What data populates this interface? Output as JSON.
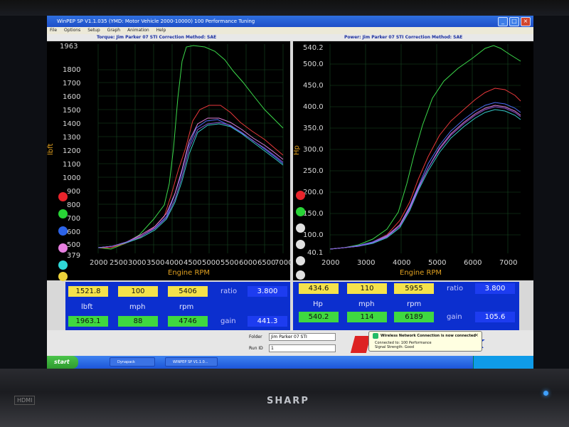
{
  "window": {
    "title": "WinPEP SP V1.1.035  (YMD: Motor Vehicle 2000-10000)  100 Performance Tuning",
    "menu": [
      "File",
      "Options",
      "Setup",
      "Graph",
      "Animation",
      "Help"
    ]
  },
  "header": {
    "left": "Torque: Jim Parker 07 STI        Correction Method: SAE",
    "right": "Power: Jim Parker 07 STI        Correction Method: SAE"
  },
  "torque_plot": {
    "ylabel": "lbft",
    "xlabel": "Engine RPM",
    "yticks": [
      "1963",
      "1800",
      "1700",
      "1600",
      "1500",
      "1400",
      "1300",
      "1200",
      "1100",
      "1000",
      "900",
      "800",
      "700",
      "600",
      "500",
      "379"
    ],
    "xticks": [
      "2000",
      "2500",
      "3000",
      "3500",
      "4000",
      "4500",
      "5000",
      "5500",
      "6000",
      "6500",
      "7000"
    ],
    "dot_colors": [
      "#e8242b",
      "#28d436",
      "#2c63e8",
      "#e77fe0",
      "#2fd8d8",
      "#ecd23a"
    ]
  },
  "power_plot": {
    "ylabel": "Hp",
    "xlabel": "Engine RPM",
    "yticks": [
      "540.2",
      "500.0",
      "450.0",
      "400.0",
      "350.0",
      "300.0",
      "250.0",
      "200.0",
      "150.0",
      "100.0",
      "40.1"
    ],
    "xticks": [
      "2000",
      "3000",
      "4000",
      "5000",
      "6000",
      "7000"
    ],
    "dot_colors": [
      "#e8242b",
      "#28d436",
      "#e0e0e0",
      "#e0e0e0",
      "#e0e0e0",
      "#e0e0e0"
    ]
  },
  "torque_panel": {
    "cursor_value": "1521.8",
    "cursor_mph": "100",
    "cursor_rpm": "5406",
    "ratio_label": "ratio",
    "ratio_value": "3.800",
    "unit_label": "lbft",
    "mph_label": "mph",
    "rpm_label": "rpm",
    "peak_value": "1963.1",
    "peak_mph": "88",
    "peak_rpm": "4746",
    "gain_label": "gain",
    "gain_value": "441.3"
  },
  "power_panel": {
    "cursor_value": "434.6",
    "cursor_mph": "110",
    "cursor_rpm": "5955",
    "ratio_label": "ratio",
    "ratio_value": "3.800",
    "unit_label": "Hp",
    "mph_label": "mph",
    "rpm_label": "rpm",
    "peak_value": "540.2",
    "peak_mph": "114",
    "peak_rpm": "6189",
    "gain_label": "gain",
    "gain_value": "105.6"
  },
  "run_info": {
    "folder_label": "Folder",
    "folder_value": "Jim Parker 07 STI",
    "runid_label": "Run ID",
    "runid_value": "1"
  },
  "notification": {
    "title": "Wireless Network Connection is now connected",
    "line1": "Connected to: 100 Performance",
    "line2": "Signal Strength: Good"
  },
  "taskbar": {
    "start_label": "start",
    "tasks": [
      "Dynapack",
      "WINPEP SP V1.1.0..."
    ]
  },
  "monitor": {
    "brand": "SHARP",
    "port_label": "HDMI"
  }
}
